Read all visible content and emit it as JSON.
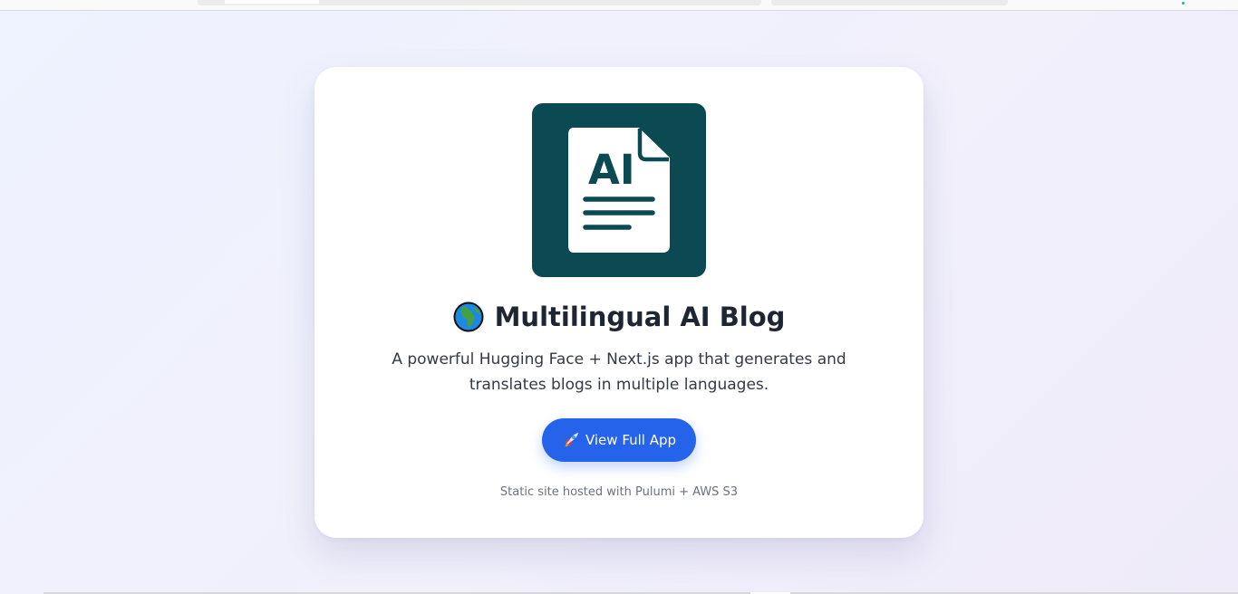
{
  "logo": {
    "text": "AI",
    "background_color": "#0b4a52",
    "icon": "ai-document-icon"
  },
  "header": {
    "emoji_icon": "globe-icon",
    "title": "Multilingual AI Blog"
  },
  "description": "A powerful Hugging Face + Next.js app that generates and translates blogs in multiple languages.",
  "cta": {
    "icon": "rocket-icon",
    "label": "View Full App",
    "color": "#2563eb"
  },
  "footer": {
    "note": "Static site hosted with Pulumi + AWS S3"
  }
}
